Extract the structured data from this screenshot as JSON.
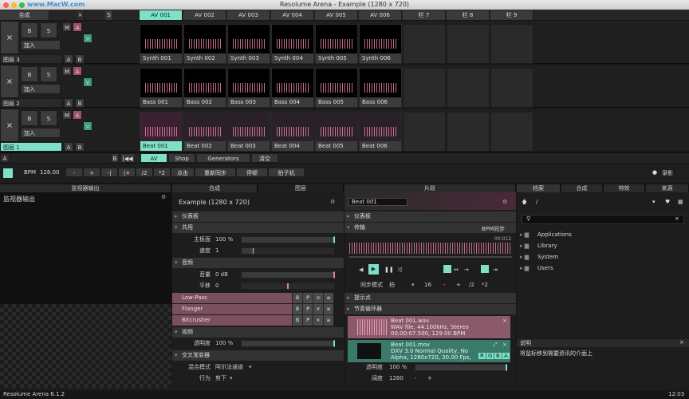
{
  "app": {
    "window_title": "Resolume Arena - Example (1280 x 720)",
    "watermark": "www.MacW.com",
    "version": "Resolume Arena 6.1.2",
    "clock": "12:03"
  },
  "topbar": {
    "composition_label": "合成",
    "s_label": "S",
    "columns": [
      "AV 001",
      "AV 002",
      "AV 003",
      "AV 004",
      "AV 005",
      "AV 006",
      "栏 7",
      "栏 8",
      "栏 9"
    ]
  },
  "layers": [
    {
      "name": "图层 3",
      "add": "加入",
      "clips": [
        "Synth 001",
        "Synth 002",
        "Synth 003",
        "Synth 004",
        "Synth 005",
        "Synth 006"
      ]
    },
    {
      "name": "图层 2",
      "add": "加入",
      "clips": [
        "Bass 001",
        "Bass 002",
        "Bass 003",
        "Bass 004",
        "Bass 005",
        "Bass 006"
      ]
    },
    {
      "name": "图层 1",
      "add": "加入",
      "clips": [
        "Beat 001",
        "Beat 002",
        "Beat 003",
        "Beat 004",
        "Beat 005",
        "Beat 006"
      ]
    }
  ],
  "layer_buttons": {
    "close": "×",
    "b": "B",
    "s": "S",
    "m": "M",
    "a": "A",
    "v": "V"
  },
  "deck": {
    "a": "A",
    "b": "B",
    "tabs": [
      "AV",
      "Shop",
      "Generators",
      "清空"
    ]
  },
  "transport": {
    "bpm_label": "BPM",
    "bpm": "128.00",
    "minus": "-",
    "plus": "+",
    "bar": "-|",
    "barplus": "|+",
    "div": "/2",
    "mul": "*2",
    "tap": "点击",
    "resync": "重新同步",
    "pause": "停顿",
    "metronome": "拍子机",
    "record": "录影"
  },
  "panels": {
    "monitor_header": "监视器输出",
    "monitor_label": "监视器输出",
    "comp_tab": "合成",
    "layer_tab": "图层",
    "clip_tab": "片段",
    "files_tab": "档案",
    "compo_tab2": "合成",
    "effects_tab": "特效",
    "sources_tab": "来源"
  },
  "composition": {
    "title": "Example (1280 x 720)",
    "dashboard": "仪表板",
    "shared": "共用",
    "master_label": "主板面",
    "master_value": "100 %",
    "speed_label": "速度",
    "speed_value": "1",
    "audio": "音频",
    "volume_label": "音量",
    "volume_value": "0 dB",
    "pan_label": "平移",
    "pan_value": "0",
    "effects": [
      "Low-Pass",
      "Flanger",
      "Bitcrusher"
    ],
    "fx_buttons": [
      "B",
      "P",
      "×",
      "≡"
    ],
    "video": "视频",
    "opacity_label": "透明度",
    "opacity_value": "100 %",
    "crossfader": "交叉渐变器",
    "blend_label": "混合模式",
    "blend_value": "阿尔法通道",
    "behaviour_label": "行为",
    "behaviour_value": "剪下"
  },
  "clip": {
    "name": "Beat 001",
    "dashboard": "仪表板",
    "transport": "传输",
    "bpm_sync": "BPM同步",
    "time": "00:012",
    "sync_mode_label": "同步模式",
    "sync_mode_value": "拍",
    "beats": "16",
    "minus": "-",
    "plus": "+",
    "div": "/2",
    "mul": "*2",
    "cue": "提示点",
    "looper": "节奏循环器",
    "audio_file": "Beat 001.wav",
    "audio_info": "WAV file, 44.100kHz, Stereo",
    "audio_dur": "00:00:07.500, 129.00 BPM",
    "video_file": "Beat 001.mov",
    "video_info": "DXV 3.0 Normal Quality, No",
    "video_info2": "Alpha, 1280x720, 30.00 Fps,",
    "rgba": [
      "R",
      "G",
      "B",
      "A"
    ],
    "opacity_label": "透明度",
    "opacity_value": "100 %",
    "width_label": "阔度",
    "width_value": "1280"
  },
  "browser": {
    "path": "/",
    "search_placeholder": "",
    "folders": [
      "Applications",
      "Library",
      "System",
      "Users"
    ],
    "info_title": "说明",
    "info_text": "将鼠标移到需要资讯的介面上"
  }
}
